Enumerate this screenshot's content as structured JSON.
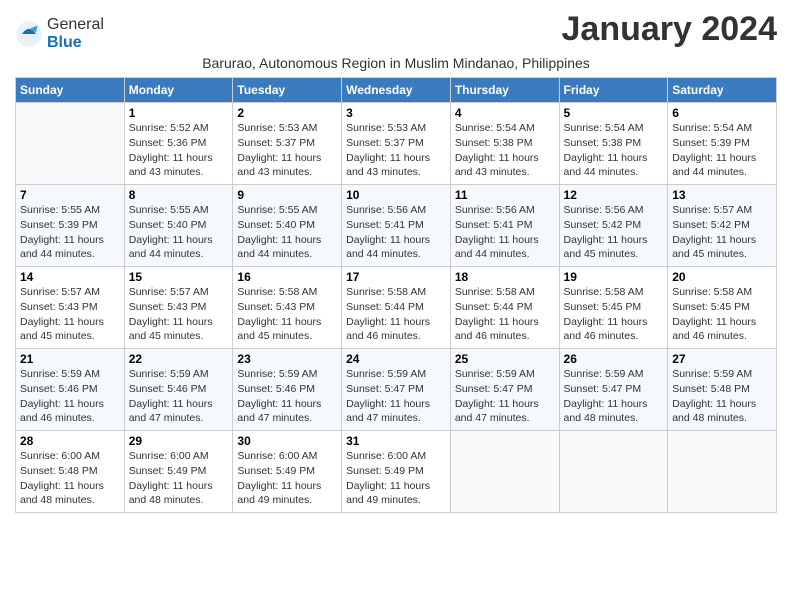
{
  "logo": {
    "general": "General",
    "blue": "Blue"
  },
  "title": "January 2024",
  "subtitle": "Barurao, Autonomous Region in Muslim Mindanao, Philippines",
  "weekdays": [
    "Sunday",
    "Monday",
    "Tuesday",
    "Wednesday",
    "Thursday",
    "Friday",
    "Saturday"
  ],
  "weeks": [
    [
      {
        "day": "",
        "info": ""
      },
      {
        "day": "1",
        "info": "Sunrise: 5:52 AM\nSunset: 5:36 PM\nDaylight: 11 hours\nand 43 minutes."
      },
      {
        "day": "2",
        "info": "Sunrise: 5:53 AM\nSunset: 5:37 PM\nDaylight: 11 hours\nand 43 minutes."
      },
      {
        "day": "3",
        "info": "Sunrise: 5:53 AM\nSunset: 5:37 PM\nDaylight: 11 hours\nand 43 minutes."
      },
      {
        "day": "4",
        "info": "Sunrise: 5:54 AM\nSunset: 5:38 PM\nDaylight: 11 hours\nand 43 minutes."
      },
      {
        "day": "5",
        "info": "Sunrise: 5:54 AM\nSunset: 5:38 PM\nDaylight: 11 hours\nand 44 minutes."
      },
      {
        "day": "6",
        "info": "Sunrise: 5:54 AM\nSunset: 5:39 PM\nDaylight: 11 hours\nand 44 minutes."
      }
    ],
    [
      {
        "day": "7",
        "info": "Sunrise: 5:55 AM\nSunset: 5:39 PM\nDaylight: 11 hours\nand 44 minutes."
      },
      {
        "day": "8",
        "info": "Sunrise: 5:55 AM\nSunset: 5:40 PM\nDaylight: 11 hours\nand 44 minutes."
      },
      {
        "day": "9",
        "info": "Sunrise: 5:55 AM\nSunset: 5:40 PM\nDaylight: 11 hours\nand 44 minutes."
      },
      {
        "day": "10",
        "info": "Sunrise: 5:56 AM\nSunset: 5:41 PM\nDaylight: 11 hours\nand 44 minutes."
      },
      {
        "day": "11",
        "info": "Sunrise: 5:56 AM\nSunset: 5:41 PM\nDaylight: 11 hours\nand 44 minutes."
      },
      {
        "day": "12",
        "info": "Sunrise: 5:56 AM\nSunset: 5:42 PM\nDaylight: 11 hours\nand 45 minutes."
      },
      {
        "day": "13",
        "info": "Sunrise: 5:57 AM\nSunset: 5:42 PM\nDaylight: 11 hours\nand 45 minutes."
      }
    ],
    [
      {
        "day": "14",
        "info": "Sunrise: 5:57 AM\nSunset: 5:43 PM\nDaylight: 11 hours\nand 45 minutes."
      },
      {
        "day": "15",
        "info": "Sunrise: 5:57 AM\nSunset: 5:43 PM\nDaylight: 11 hours\nand 45 minutes."
      },
      {
        "day": "16",
        "info": "Sunrise: 5:58 AM\nSunset: 5:43 PM\nDaylight: 11 hours\nand 45 minutes."
      },
      {
        "day": "17",
        "info": "Sunrise: 5:58 AM\nSunset: 5:44 PM\nDaylight: 11 hours\nand 46 minutes."
      },
      {
        "day": "18",
        "info": "Sunrise: 5:58 AM\nSunset: 5:44 PM\nDaylight: 11 hours\nand 46 minutes."
      },
      {
        "day": "19",
        "info": "Sunrise: 5:58 AM\nSunset: 5:45 PM\nDaylight: 11 hours\nand 46 minutes."
      },
      {
        "day": "20",
        "info": "Sunrise: 5:58 AM\nSunset: 5:45 PM\nDaylight: 11 hours\nand 46 minutes."
      }
    ],
    [
      {
        "day": "21",
        "info": "Sunrise: 5:59 AM\nSunset: 5:46 PM\nDaylight: 11 hours\nand 46 minutes."
      },
      {
        "day": "22",
        "info": "Sunrise: 5:59 AM\nSunset: 5:46 PM\nDaylight: 11 hours\nand 47 minutes."
      },
      {
        "day": "23",
        "info": "Sunrise: 5:59 AM\nSunset: 5:46 PM\nDaylight: 11 hours\nand 47 minutes."
      },
      {
        "day": "24",
        "info": "Sunrise: 5:59 AM\nSunset: 5:47 PM\nDaylight: 11 hours\nand 47 minutes."
      },
      {
        "day": "25",
        "info": "Sunrise: 5:59 AM\nSunset: 5:47 PM\nDaylight: 11 hours\nand 47 minutes."
      },
      {
        "day": "26",
        "info": "Sunrise: 5:59 AM\nSunset: 5:47 PM\nDaylight: 11 hours\nand 48 minutes."
      },
      {
        "day": "27",
        "info": "Sunrise: 5:59 AM\nSunset: 5:48 PM\nDaylight: 11 hours\nand 48 minutes."
      }
    ],
    [
      {
        "day": "28",
        "info": "Sunrise: 6:00 AM\nSunset: 5:48 PM\nDaylight: 11 hours\nand 48 minutes."
      },
      {
        "day": "29",
        "info": "Sunrise: 6:00 AM\nSunset: 5:49 PM\nDaylight: 11 hours\nand 48 minutes."
      },
      {
        "day": "30",
        "info": "Sunrise: 6:00 AM\nSunset: 5:49 PM\nDaylight: 11 hours\nand 49 minutes."
      },
      {
        "day": "31",
        "info": "Sunrise: 6:00 AM\nSunset: 5:49 PM\nDaylight: 11 hours\nand 49 minutes."
      },
      {
        "day": "",
        "info": ""
      },
      {
        "day": "",
        "info": ""
      },
      {
        "day": "",
        "info": ""
      }
    ]
  ]
}
